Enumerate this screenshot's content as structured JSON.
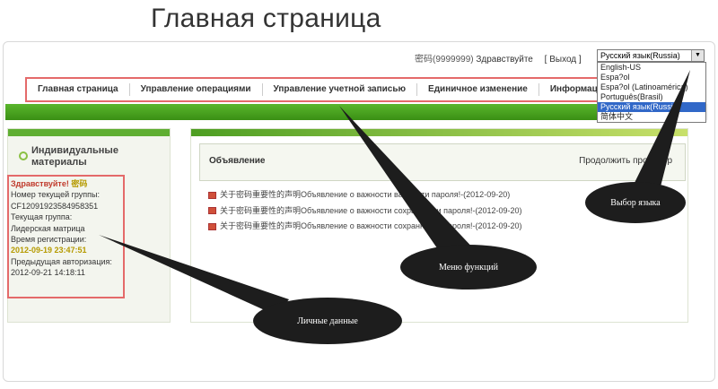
{
  "slide": {
    "title": "Главная страница"
  },
  "header": {
    "username": "密码(9999999)",
    "greeting": "Здравствуйте",
    "exit_label": "[ Выход ]",
    "language_selected": "Русский язык(Russia)",
    "language_options": [
      "English-US",
      "Espa?ol",
      "Espa?ol (Latinoamérica)",
      "Português(Brasil)",
      "Русский язык(Russia)",
      "简体中文"
    ]
  },
  "nav": {
    "items": [
      "Главная страница",
      "Управление операциями",
      "Управление учетной записью",
      "Единичное изменение",
      "Информац"
    ]
  },
  "left_panel": {
    "heading_line1": "Индивидуальные",
    "heading_line2": "материалы",
    "hello": "Здравствуйте!",
    "hello_name": "密码",
    "group_no_label": "Номер текущей группы:",
    "group_no": "CF12091923584958351",
    "group_label": "Текущая группа:",
    "group": "Лидерская матрица",
    "reg_label": "Время регистрации:",
    "reg_time": "2012-09-19 23:47:51",
    "prev_label": "Предыдущая авторизация:",
    "prev_time": "2012-09-21 14:18:11"
  },
  "announcements": {
    "title": "Объявление",
    "more": "Продолжить просмотр",
    "items": [
      "关于密码重要性的声明Объявление о важности важности пароля!-(2012-09-20)",
      "关于密码重要性的声明Объявление о важности сохранности пароля!-(2012-09-20)",
      "关于密码重要性的声明Объявление о важности сохранности пароля!-(2012-09-20)"
    ]
  },
  "callouts": {
    "language": "Выбор языка",
    "menu": "Меню функций",
    "personal": "Личные данные"
  }
}
